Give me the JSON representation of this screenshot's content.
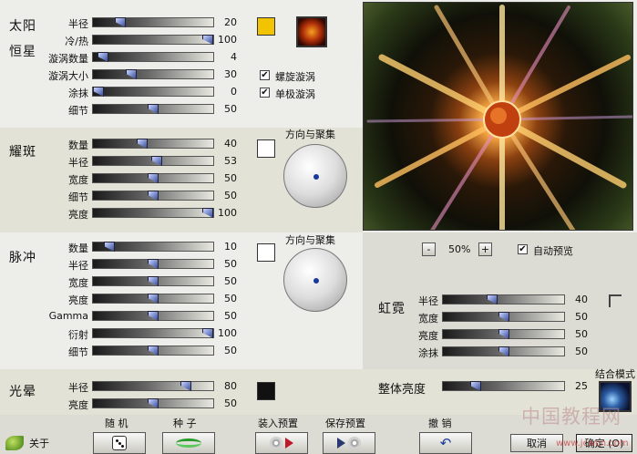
{
  "sun": {
    "title_line1": "太阳",
    "title_line2": "恒星",
    "sliders": [
      {
        "label": "半径",
        "value": "20",
        "fraction": 0.2
      },
      {
        "label": "冷/热",
        "value": "100",
        "fraction": 1.0
      },
      {
        "label": "漩涡数量",
        "value": "4",
        "fraction": 0.04
      },
      {
        "label": "漩涡大小",
        "value": "30",
        "fraction": 0.3
      },
      {
        "label": "涂抹",
        "value": "0",
        "fraction": 0.0
      },
      {
        "label": "细节",
        "value": "50",
        "fraction": 0.5
      }
    ],
    "checkboxes": [
      {
        "label": "螺旋漩涡",
        "checked": true
      },
      {
        "label": "单极漩涡",
        "checked": true
      }
    ],
    "swatch_color": "#f2c300"
  },
  "flare": {
    "title": "耀斑",
    "dial_title": "方向与聚集",
    "sliders": [
      {
        "label": "数量",
        "value": "40",
        "fraction": 0.4
      },
      {
        "label": "半径",
        "value": "53",
        "fraction": 0.53
      },
      {
        "label": "宽度",
        "value": "50",
        "fraction": 0.5
      },
      {
        "label": "细节",
        "value": "50",
        "fraction": 0.5
      },
      {
        "label": "亮度",
        "value": "100",
        "fraction": 1.0
      }
    ],
    "swatch_color": "#ffffff"
  },
  "pulse": {
    "title": "脉冲",
    "dial_title": "方向与聚集",
    "sliders": [
      {
        "label": "数量",
        "value": "10",
        "fraction": 0.1
      },
      {
        "label": "半径",
        "value": "50",
        "fraction": 0.5
      },
      {
        "label": "宽度",
        "value": "50",
        "fraction": 0.5
      },
      {
        "label": "亮度",
        "value": "50",
        "fraction": 0.5
      },
      {
        "label": "Gamma",
        "value": "50",
        "fraction": 0.5
      },
      {
        "label": "衍射",
        "value": "100",
        "fraction": 1.0
      },
      {
        "label": "细节",
        "value": "50",
        "fraction": 0.5
      }
    ],
    "swatch_color": "#ffffff"
  },
  "halo": {
    "title": "光晕",
    "sliders": [
      {
        "label": "半径",
        "value": "80",
        "fraction": 0.8
      },
      {
        "label": "亮度",
        "value": "50",
        "fraction": 0.5
      }
    ],
    "swatch_color": "#111111"
  },
  "preview": {
    "zoom_minus": "-",
    "zoom_value": "50%",
    "zoom_plus": "+",
    "auto_preview_label": "自动预览",
    "auto_preview_checked": true
  },
  "rainbow": {
    "title": "虹霓",
    "sliders": [
      {
        "label": "半径",
        "value": "40",
        "fraction": 0.4
      },
      {
        "label": "宽度",
        "value": "50",
        "fraction": 0.5
      },
      {
        "label": "亮度",
        "value": "50",
        "fraction": 0.5
      },
      {
        "label": "涂抹",
        "value": "50",
        "fraction": 0.5
      }
    ]
  },
  "overall": {
    "label": "整体亮度",
    "value": "25",
    "fraction": 0.25,
    "blend_mode_label": "结合模式"
  },
  "bottom": {
    "about": "关于",
    "random_caption": "随 机",
    "seed_caption": "种 子",
    "load_preset_caption": "装入预置",
    "save_preset_caption": "保存预置",
    "undo_caption": "撤 销",
    "cancel": "取消",
    "ok": "确定 (O)"
  },
  "watermark": {
    "line1": "中国教程网",
    "line2": "www.jcwcn.com"
  }
}
